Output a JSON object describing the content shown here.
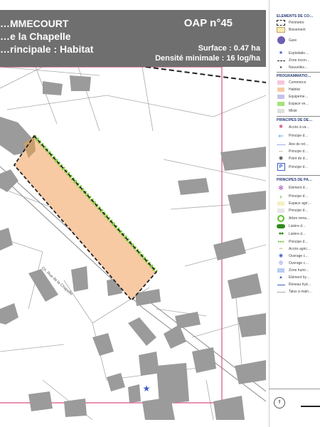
{
  "header": {
    "commune": "…MMECOURT",
    "site": "…e la Chapelle",
    "vocation": "…rincipale : Habitat",
    "oap_number": "OAP n°45",
    "surface": "Surface : 0.47 ha",
    "density": "Densité minimale : 16 log/ha"
  },
  "map": {
    "street_label": "Ch. Rue de la Chapelle",
    "colors": {
      "background": "#ffffff",
      "building": "#9b9b9b",
      "parcel_line": "#a9a9a9",
      "habitat_zone": "#f7caa4",
      "planting_edge": "#7ed23b",
      "perimeter": "#222222",
      "pink_boundary": "#d94f87",
      "woodland": "#c8a070",
      "access_star": "#3d5ac8"
    }
  },
  "legend": {
    "sections": [
      "ELEMENTS DE CO…",
      "PROGRAMMATIO…",
      "PRINCIPES DE DE…",
      "PRINCIPES DE PA…"
    ],
    "items": [
      {
        "label": "Périmètre",
        "symbol": "dashed-rect-icon"
      },
      {
        "label": "Boisement",
        "symbol": "woodland-swatch-icon"
      },
      {
        "label": "Gare",
        "symbol": "train-station-icon"
      },
      {
        "label": "Exploitatio…",
        "symbol": "blue-star-icon"
      },
      {
        "label": "Zone incon…",
        "symbol": "dashed-line-icon"
      },
      {
        "label": "Nouvelles…",
        "symbol": "small-star-icon"
      },
      {
        "label": "Commerce",
        "symbol": "pink-swatch-icon"
      },
      {
        "label": "Habitat",
        "symbol": "orange-swatch-icon"
      },
      {
        "label": "Equipeme…",
        "symbol": "purple-swatch-icon"
      },
      {
        "label": "Espace ve…",
        "symbol": "green-swatch-icon"
      },
      {
        "label": "Mixte",
        "symbol": "grey-swatch-icon"
      },
      {
        "label": "Accès à va…",
        "symbol": "red-star-icon"
      },
      {
        "label": "Principe d…",
        "symbol": "blue-arrow-icon"
      },
      {
        "label": "Aire de ret…",
        "symbol": "dotted-line-icon"
      },
      {
        "label": "Principe d…",
        "symbol": "brown-dashed-arrow-icon"
      },
      {
        "label": "Point de d…",
        "symbol": "point-icon"
      },
      {
        "label": "Principe d…",
        "symbol": "parking-icon"
      },
      {
        "label": "Elément d…",
        "symbol": "purple-flower-icon"
      },
      {
        "label": "Principe d…",
        "symbol": "green-chevron-icon"
      },
      {
        "label": "Espace agri…",
        "symbol": "yellow-swatch-icon"
      },
      {
        "label": "Principe d…",
        "symbol": "light-grey-swatch-icon"
      },
      {
        "label": "Arbre rema…",
        "symbol": "green-ring-icon"
      },
      {
        "label": "Lisière d…",
        "symbol": "green-hedge-icon"
      },
      {
        "label": "Lisière d…",
        "symbol": "double-green-circle-icon"
      },
      {
        "label": "Principe d…",
        "symbol": "green-dots-icon"
      },
      {
        "label": "Accès agric…",
        "symbol": "double-arrow-icon"
      },
      {
        "label": "Ouvrage c…",
        "symbol": "blue-circle-icon"
      },
      {
        "label": "Ouvrage c…",
        "symbol": "blue-ring-icon"
      },
      {
        "label": "Zone humi…",
        "symbol": "blue-swatch-icon"
      },
      {
        "label": "Elément hy…",
        "symbol": "blue-triangle-icon"
      },
      {
        "label": "Réseau hyd…",
        "symbol": "blue-line-icon"
      },
      {
        "label": "Talus à main…",
        "symbol": "dotted-grey-icon"
      }
    ]
  }
}
